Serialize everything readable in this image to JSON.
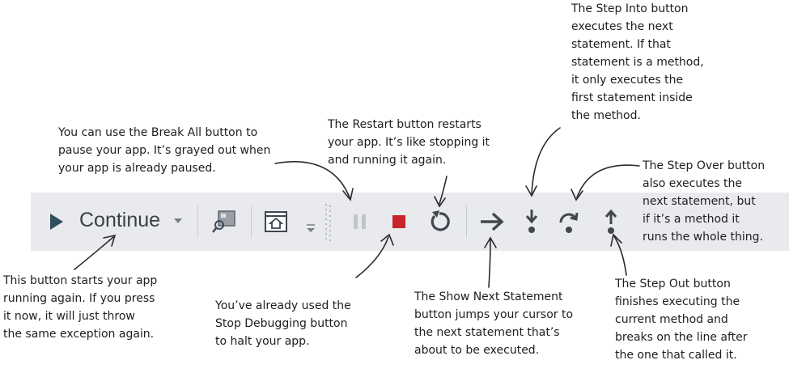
{
  "toolbar": {
    "continue_label": "Continue",
    "buttons": [
      {
        "name": "continue",
        "icon": "play-icon"
      },
      {
        "name": "continue-dropdown",
        "icon": "chevron-down-icon"
      },
      {
        "name": "find-window",
        "icon": "window-search-icon"
      },
      {
        "name": "app-window",
        "icon": "window-home-icon"
      },
      {
        "name": "break-all",
        "icon": "pause-icon",
        "state": "disabled"
      },
      {
        "name": "stop-debugging",
        "icon": "stop-icon"
      },
      {
        "name": "restart",
        "icon": "restart-icon"
      },
      {
        "name": "show-next-statement",
        "icon": "arrow-right-icon"
      },
      {
        "name": "step-into",
        "icon": "step-into-icon"
      },
      {
        "name": "step-over",
        "icon": "step-over-icon"
      },
      {
        "name": "step-out",
        "icon": "step-out-icon"
      }
    ],
    "colors": {
      "background": "#e9eaee",
      "icon": "#41464f",
      "stop": "#c8232a",
      "disabled": "#c2c4ca"
    }
  },
  "annotations": {
    "step_into": "The Step Into button\nexecutes the next\nstatement. If that\nstatement is a method,\nit only executes the\nfirst statement inside\nthe method.",
    "break_all": "You can use the Break All button to\npause your app. It’s grayed out when\nyour app is already paused.",
    "restart": "The Restart button restarts\nyour app. It’s like stopping it\nand running it again.",
    "step_over": "The Step Over button\nalso executes the\nnext statement, but\nif it’s a method it\nruns the whole thing.",
    "continue": "This button starts your app\nrunning again. If you press\nit now, it will just throw\nthe same exception again.",
    "stop_debugging": "You’ve already used the\nStop Debugging button\nto halt your app.",
    "show_next_statement": "The Show Next Statement\nbutton jumps your cursor to\nthe next statement that’s\nabout to be executed.",
    "step_out": "The Step Out button\nfinishes executing the\ncurrent method and\nbreaks on the line after\nthe one that called it."
  }
}
